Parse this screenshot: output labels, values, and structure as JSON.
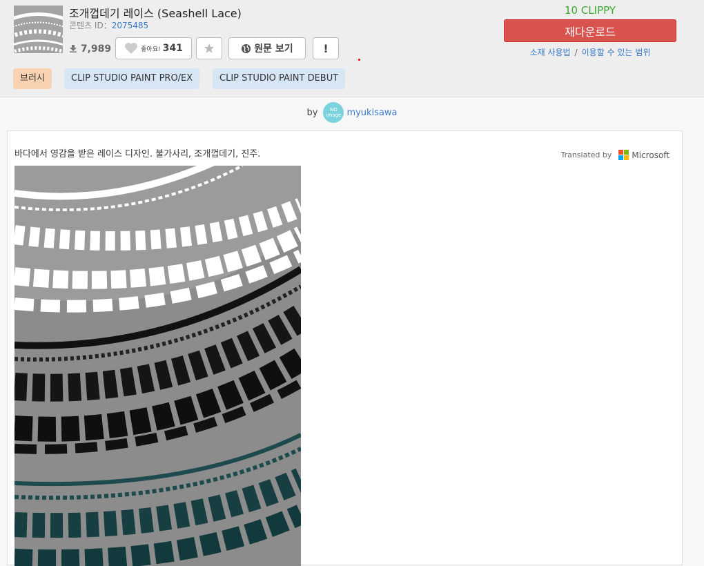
{
  "content": {
    "title": "조개껍데기 레이스 (Seashell Lace)",
    "id_label": "콘텐츠 ID：",
    "id_value": "2075485",
    "downloads": "7,989",
    "like_label": "좋아요!",
    "like_count": "341",
    "original_button": "원문 보기",
    "report_button": "!"
  },
  "tags": [
    "브러시",
    "CLIP STUDIO PAINT PRO/EX",
    "CLIP STUDIO PAINT DEBUT"
  ],
  "purchase": {
    "price": "10 CLIPPY",
    "redownload": "재다운로드",
    "link_usage": "소재 사용법",
    "link_separator": "/",
    "link_scope": "이용할 수 있는 범위"
  },
  "author": {
    "by": "by",
    "avatar_text": "NO image",
    "name": "myukisawa"
  },
  "description": {
    "text": "바다에서 영감을 받은 레이스 디자인. 불가사리, 조개껍데기, 진주.",
    "translated_by": "Translated by",
    "translator": "Microsoft"
  },
  "colors": {
    "redownload_bg": "#d9534f",
    "price": "#3aaa2e",
    "link": "#3a7bc8",
    "ms_red": "#f25022",
    "ms_green": "#7fba00",
    "ms_blue": "#00a4ef",
    "ms_yellow": "#ffb900"
  },
  "icons": [
    "download-icon",
    "heart-icon",
    "star-icon",
    "globe-icon",
    "microsoft-logo"
  ]
}
